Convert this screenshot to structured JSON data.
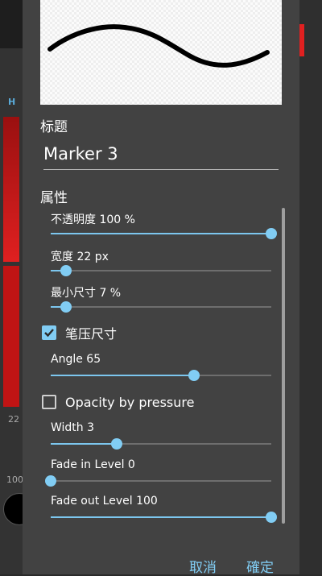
{
  "background": {
    "left_label_a": "H",
    "left_label_b": "22",
    "left_label_c": "100"
  },
  "dialog": {
    "title_label": "标题",
    "brush_name": "Marker 3",
    "properties_label": "属性",
    "sliders": [
      {
        "label": "不透明度 100 %",
        "value": 1.0
      },
      {
        "label": "宽度 22 px",
        "value": 0.07
      },
      {
        "label": "最小尺寸 7 %",
        "value": 0.07
      }
    ],
    "pressure_size": {
      "label": "笔压尺寸",
      "checked": true
    },
    "angle": {
      "label": "Angle 65",
      "value": 0.65
    },
    "opacity_pressure": {
      "label": "Opacity by pressure",
      "checked": false
    },
    "sliders2": [
      {
        "label": "Width 3",
        "value": 0.3
      },
      {
        "label": "Fade in Level  0",
        "value": 0.0
      },
      {
        "label": "Fade out Level 100",
        "value": 1.0
      }
    ],
    "cancel_label": "取消",
    "ok_label": "確定"
  },
  "colors": {
    "accent": "#81cdf4",
    "dialog_bg": "#424242"
  }
}
